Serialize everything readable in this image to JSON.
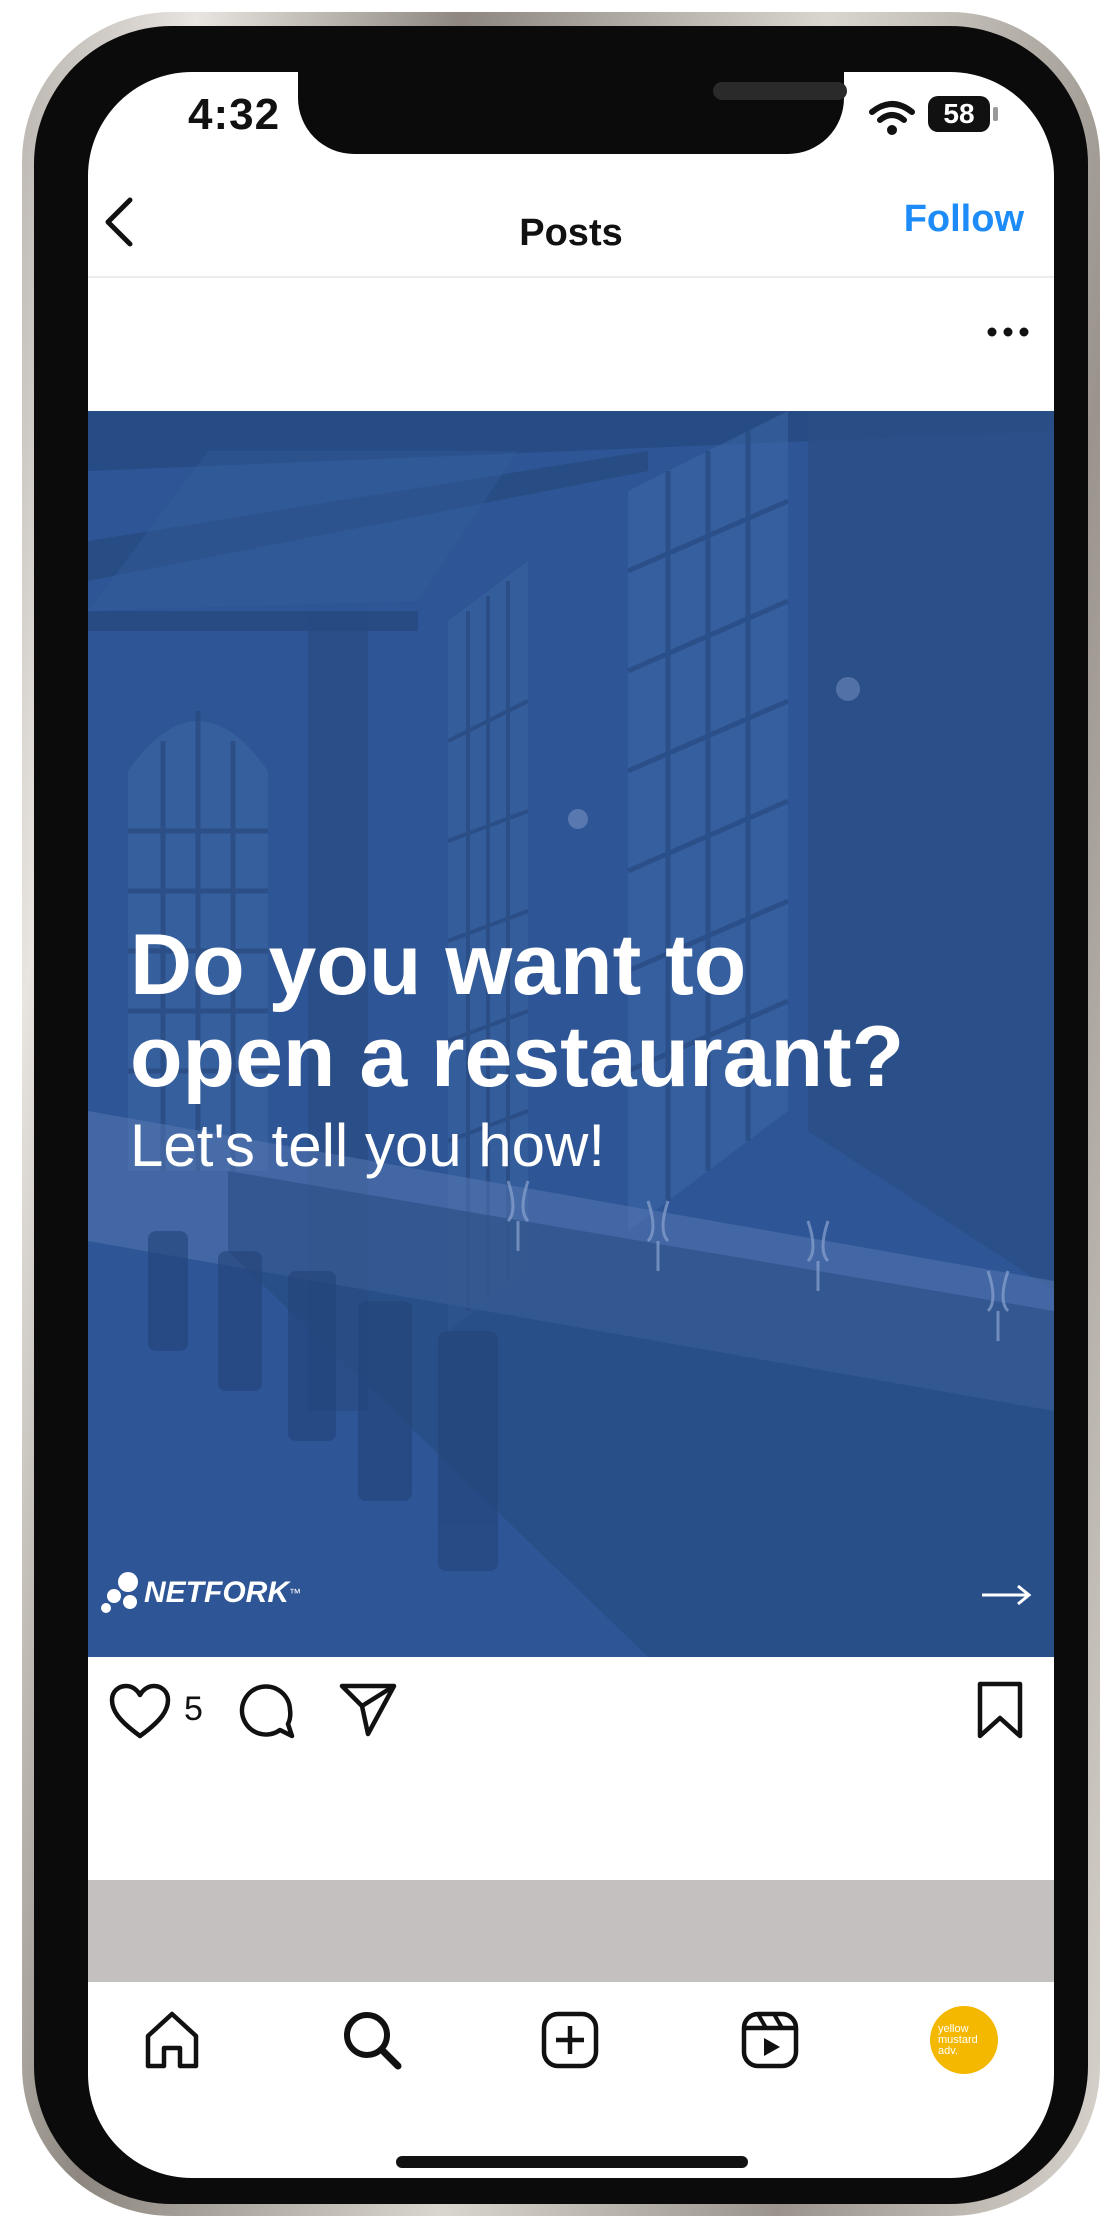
{
  "status_bar": {
    "time": "4:32",
    "battery": "58"
  },
  "header": {
    "title": "Posts",
    "follow_label": "Follow"
  },
  "post": {
    "headline_line1": "Do you want to",
    "headline_line2": "open a restaurant?",
    "subline": "Let's tell you how!",
    "brand": "NETFORK",
    "brand_mark": "™",
    "likes": "5",
    "overlay_color": "#2e5595"
  },
  "avatar": {
    "line1": "yellow",
    "line2": "mustard",
    "line3": "adv."
  },
  "colors": {
    "accent": "#1d8cf8",
    "avatar": "#f5b800",
    "band": "#c4c0bf"
  }
}
